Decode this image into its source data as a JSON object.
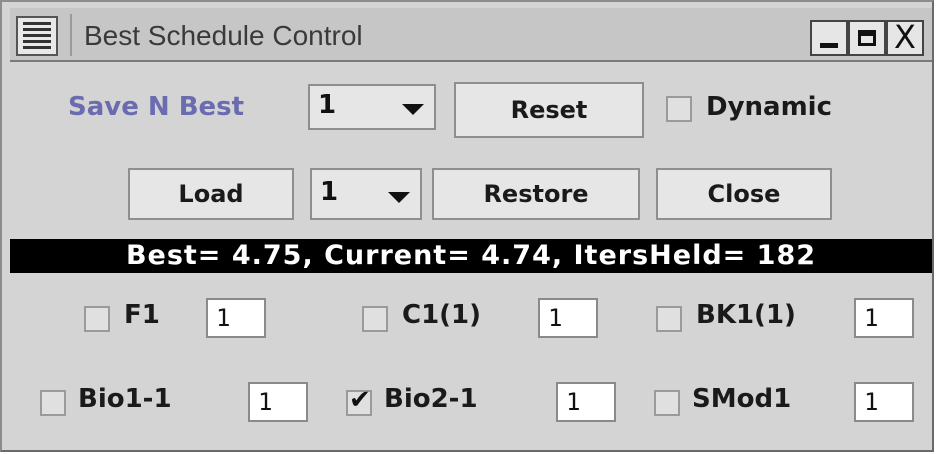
{
  "window": {
    "title": "Best Schedule Control",
    "controls": {
      "minimize": "_",
      "maximize": "□",
      "close": "X"
    }
  },
  "row1": {
    "save_label": "Save N Best",
    "save_n_value": "1",
    "reset_label": "Reset",
    "dynamic_label": "Dynamic",
    "dynamic_checked": false
  },
  "row2": {
    "load_label": "Load",
    "load_value": "1",
    "restore_label": "Restore",
    "close_label": "Close"
  },
  "status": {
    "text": "Best= 4.75, Current= 4.74, ItersHeld= 182"
  },
  "items": [
    {
      "label": "F1",
      "checked": false,
      "value": "1"
    },
    {
      "label": "C1(1)",
      "checked": false,
      "value": "1"
    },
    {
      "label": "BK1(1)",
      "checked": false,
      "value": "1"
    },
    {
      "label": "Bio1-1",
      "checked": false,
      "value": "1"
    },
    {
      "label": "Bio2-1",
      "checked": true,
      "value": "1",
      "check_mark": "✔"
    },
    {
      "label": "SMod1",
      "checked": false,
      "value": "1"
    }
  ],
  "colors": {
    "save_label": "#6b6bb0",
    "status_bg": "#000000",
    "status_fg": "#ffffff",
    "panel_bg": "#d4d4d4"
  }
}
